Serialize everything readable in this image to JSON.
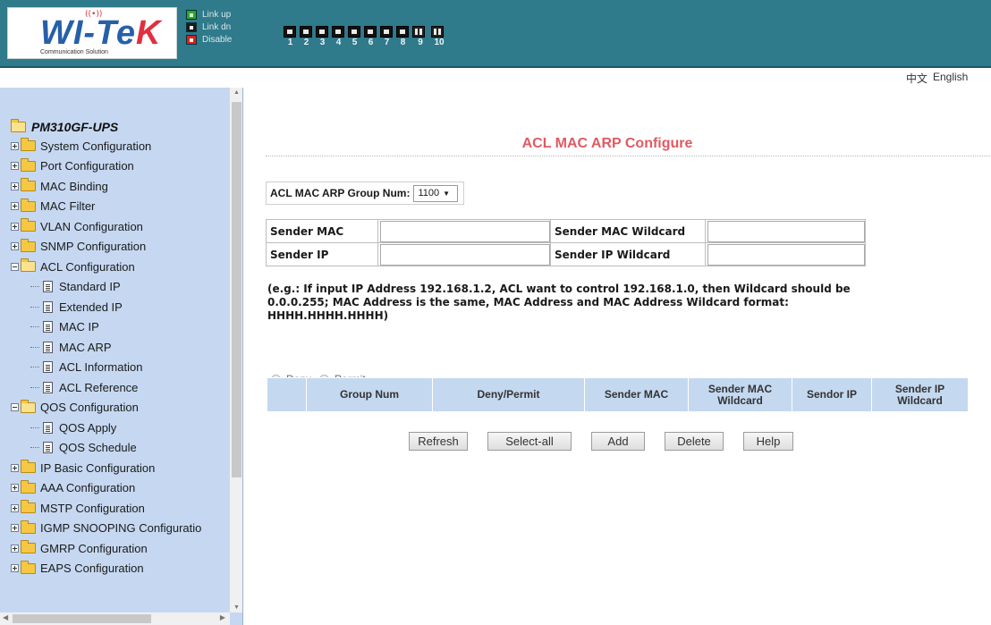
{
  "header": {
    "logo_text": "WI-TEK",
    "logo_subtitle": "Communication Solution",
    "legend": [
      {
        "label": "Link up",
        "state": "up"
      },
      {
        "label": "Link dn",
        "state": "down"
      },
      {
        "label": "Disable",
        "state": "disable"
      }
    ],
    "ports": [
      {
        "num": "1",
        "type": "rj45"
      },
      {
        "num": "2",
        "type": "rj45"
      },
      {
        "num": "3",
        "type": "rj45"
      },
      {
        "num": "4",
        "type": "rj45"
      },
      {
        "num": "5",
        "type": "rj45"
      },
      {
        "num": "6",
        "type": "rj45"
      },
      {
        "num": "7",
        "type": "rj45"
      },
      {
        "num": "8",
        "type": "rj45"
      },
      {
        "num": "9",
        "type": "sfp"
      },
      {
        "num": "10",
        "type": "sfp"
      }
    ],
    "colors": {
      "bar": "#2f7a8b",
      "link_up": "#1db11a",
      "link_dn": "#1a1a1a",
      "disable": "#d8231e"
    }
  },
  "langbar": {
    "chinese": "中文",
    "english": "English"
  },
  "sidebar": {
    "root": "PM310GF-UPS",
    "nodes": [
      {
        "label": "System Configuration",
        "kind": "folder",
        "expanded": false
      },
      {
        "label": "Port Configuration",
        "kind": "folder",
        "expanded": false
      },
      {
        "label": "MAC Binding",
        "kind": "folder",
        "expanded": false
      },
      {
        "label": "MAC Filter",
        "kind": "folder",
        "expanded": false
      },
      {
        "label": "VLAN Configuration",
        "kind": "folder",
        "expanded": false
      },
      {
        "label": "SNMP Configuration",
        "kind": "folder",
        "expanded": false
      },
      {
        "label": "ACL Configuration",
        "kind": "folder",
        "expanded": true
      },
      {
        "label": "Standard IP",
        "kind": "page"
      },
      {
        "label": "Extended IP",
        "kind": "page"
      },
      {
        "label": "MAC IP",
        "kind": "page"
      },
      {
        "label": "MAC ARP",
        "kind": "page"
      },
      {
        "label": "ACL Information",
        "kind": "page"
      },
      {
        "label": "ACL Reference",
        "kind": "page"
      },
      {
        "label": "QOS Configuration",
        "kind": "folder",
        "expanded": true
      },
      {
        "label": "QOS Apply",
        "kind": "page"
      },
      {
        "label": "QOS Schedule",
        "kind": "page"
      },
      {
        "label": "IP Basic Configuration",
        "kind": "folder",
        "expanded": false
      },
      {
        "label": "AAA Configuration",
        "kind": "folder",
        "expanded": false
      },
      {
        "label": "MSTP Configuration",
        "kind": "folder",
        "expanded": false
      },
      {
        "label": "IGMP SNOOPING Configuratio",
        "kind": "folder",
        "expanded": false
      },
      {
        "label": "GMRP Configuration",
        "kind": "folder",
        "expanded": false
      },
      {
        "label": "EAPS Configuration",
        "kind": "folder",
        "expanded": false
      }
    ]
  },
  "main": {
    "title": "ACL MAC ARP Configure",
    "group_label": "ACL MAC ARP Group Num:",
    "group_value": "1100",
    "fields": {
      "sender_mac": {
        "label": "Sender MAC",
        "value": ""
      },
      "sender_mac_wildcard": {
        "label": "Sender MAC Wildcard",
        "value": ""
      },
      "sender_ip": {
        "label": "Sender IP",
        "value": ""
      },
      "sender_ip_wildcard": {
        "label": "Sender IP Wildcard",
        "value": ""
      }
    },
    "note": "(e.g.: If input IP Address 192.168.1.2, ACL want to control 192.168.1.0, then Wildcard should be 0.0.0.255; MAC Address is the same, MAC Address and MAC Address Wildcard format: HHHH.HHHH.HHHH)",
    "radio": {
      "deny": "Deny",
      "permit": "Permit",
      "selected": "deny"
    },
    "table_headers": [
      "",
      "Group Num",
      "Deny/Permit",
      "Sender MAC",
      "Sender MAC Wildcard",
      "Sendor IP",
      "Sender IP Wildcard"
    ],
    "buttons": {
      "refresh": "Refresh",
      "select_all": "Select-all",
      "add": "Add",
      "delete": "Delete",
      "help": "Help"
    }
  }
}
